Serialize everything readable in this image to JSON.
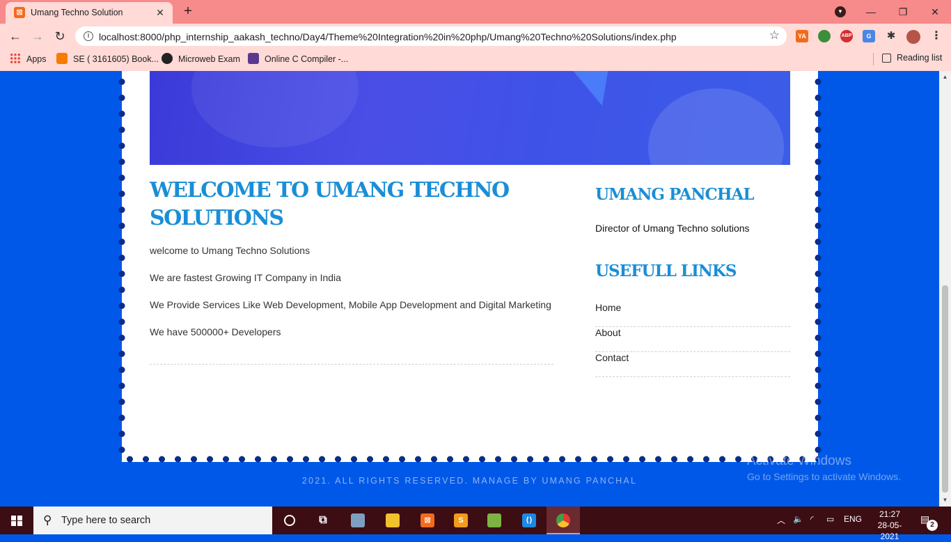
{
  "browser": {
    "tab_title": "Umang Techno Solution",
    "tab_close": "✕",
    "new_tab": "+",
    "url": "localhost:8000/php_internship_aakash_techno/Day4/Theme%20Integration%20in%20php/Umang%20Techno%20Solutions/index.php",
    "bookmarks": [
      {
        "label": "Apps"
      },
      {
        "label": "SE ( 3161605) Book..."
      },
      {
        "label": "Microweb Exam"
      },
      {
        "label": "Online C Compiler -..."
      }
    ],
    "reading_list": "Reading list",
    "extensions": [
      "YA",
      "ABP"
    ]
  },
  "page": {
    "main_title": "WELCOME TO UMANG TECHNO SOLUTIONS",
    "paragraphs": [
      "welcome to Umang Techno Solutions",
      "We are fastest Growing IT Company in India",
      "We Provide Services Like Web Development, Mobile App Development and Digital Marketing",
      "We have 500000+ Developers"
    ],
    "sidebar": {
      "author_title": "UMANG PANCHAL",
      "author_desc": "Director of Umang Techno solutions",
      "links_title": "USEFULL LINKS",
      "links": [
        "Home",
        "About",
        "Contact"
      ]
    },
    "footer": "2021. ALL RIGHTS RESERVED. MANAGE BY UMANG PANCHAL"
  },
  "watermark": {
    "title": "Activate Windows",
    "subtitle": "Go to Settings to activate Windows."
  },
  "taskbar": {
    "search_placeholder": "Type here to search",
    "language": "ENG",
    "time": "21:27",
    "date": "28-05-2021",
    "notification_count": "2"
  },
  "colors": {
    "page_background": "#0058e8",
    "heading": "#1a8ed6",
    "chrome_tabbar": "#f78a8a",
    "chrome_toolbar": "#ffdad6",
    "taskbar": "#3c0d13"
  }
}
